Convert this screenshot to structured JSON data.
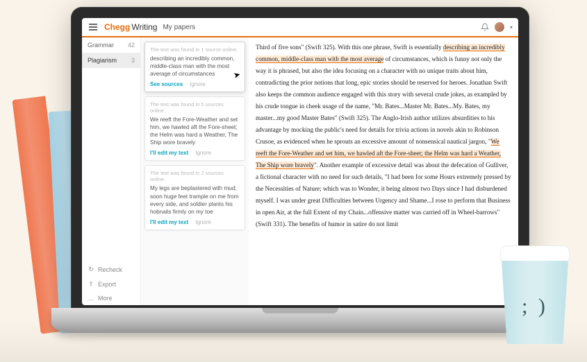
{
  "header": {
    "brand_main": "Chegg",
    "brand_sub": "Writing",
    "crumb": "My papers"
  },
  "sidebar": {
    "items": [
      {
        "label": "Grammar",
        "count": "42"
      },
      {
        "label": "Plagiarism",
        "count": "3"
      }
    ],
    "actions": [
      {
        "icon": "↻",
        "label": "Recheck"
      },
      {
        "icon": "⇪",
        "label": "Export"
      },
      {
        "icon": "…",
        "label": "More"
      }
    ]
  },
  "cards": [
    {
      "head": "The text was found in 1 source online.",
      "body": "describing an incredibly common, middle-class man with the most average of circumstances",
      "action_primary": "See sources",
      "action_secondary": "Ignore"
    },
    {
      "head": "The text was found in 5 sources online.",
      "body": "We reeft the Fore-Weather and  set him, we hawled aft the Fore-sheet; the Helm was hard a Weather, The Ship wore bravely",
      "action_primary": "I'll edit my text",
      "action_secondary": "Ignore"
    },
    {
      "head": "The text was found in 2 sources online.",
      "body": "My legs are beplastered with mud; soon huge feet trample on me from every side, and soldier plants his hobnails firmly on my toe",
      "action_primary": "I'll edit my text",
      "action_secondary": "Ignore"
    }
  ],
  "doc": {
    "p1a": "Third of five sons\" (Swift 325). With this one phrase, Swift is essentially ",
    "p1hl": "describing an incredibly common, middle-class man with the most average",
    "p1b": " of circumstances, which is funny not only the way it is phrased, but also the idea focusing on a character with no unique traits about him, contradicting the prior notions that long, epic stories should be reserved for heroes. Jonathan Swift also keeps the common audience engaged with this story with several crude jokes, as exampled by his crude tongue in cheek usage of the name, \"Mr. Bates...Master Mr. Bates...My. Bates, my master...my good Master Bates\" (Swift 325). The Anglo-Irish author utilizes absurdities to his advantage by mocking the public's need for details for trivia actions in novels akin to Robinson Crusoe, as evidenced when he sprouts an excessive amount of nonsensical nautical jargon, \"",
    "p1hl2": "We reeft the Fore-Weather and  set him, we hawled aft the Fore-sheet; the Helm was hard a Weather, The Ship wore bravely",
    "p1c": "\". Another example of excessive detail was about the defecation of Gulliver, a fictional character with no need for such details, \"I had been for some Hours extremely pressed by the Necessities of Nature; which was to Wonder, it being almost two Days since I had disburdened myself. I was under great Difficulties between Urgency and Shame...I rose to perform that Business in open Air, at the full Extent of my Chain...offensive matter was carried off in Wheel-barrows\" (Swift 331). The benefits of humor in satire do not limit"
  },
  "cup_face": "; )"
}
